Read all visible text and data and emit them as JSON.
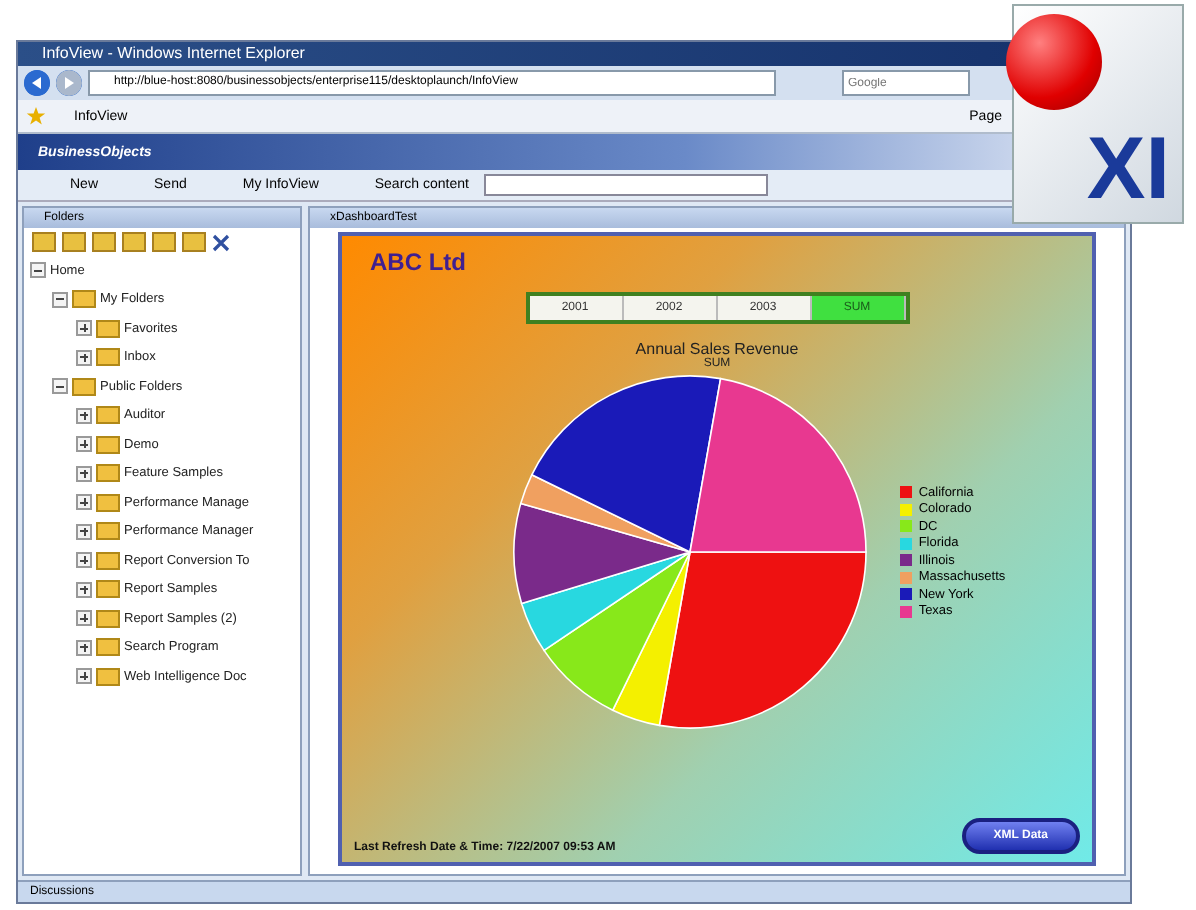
{
  "window": {
    "title": "InfoView - Windows Internet Explorer"
  },
  "address_bar": {
    "value": "http://blue-host:8080/businessobjects/enterprise115/desktoplaunch/InfoView"
  },
  "search": {
    "placeholder": "Google"
  },
  "browser_tab": {
    "label": "InfoView"
  },
  "page_menu": "Page",
  "brand": "BusinessObjects",
  "product_badge": "XI",
  "toolbar": {
    "items": [
      "New",
      "Send",
      "My InfoView"
    ],
    "search_label": "Search content"
  },
  "folders_panel": {
    "title": "Folders",
    "tree": [
      {
        "label": "Home",
        "expanded": true,
        "children": [
          {
            "label": "My Folders",
            "expanded": true,
            "children": [
              {
                "label": "Favorites",
                "expanded": false
              },
              {
                "label": "Inbox",
                "expanded": false
              }
            ]
          },
          {
            "label": "Public Folders",
            "expanded": true,
            "children": [
              {
                "label": "Auditor",
                "expanded": false
              },
              {
                "label": "Demo",
                "expanded": false
              },
              {
                "label": "Feature Samples",
                "expanded": false
              },
              {
                "label": "Performance Manage",
                "expanded": false
              },
              {
                "label": "Performance Manager",
                "expanded": false
              },
              {
                "label": "Report Conversion To",
                "expanded": false
              },
              {
                "label": "Report Samples",
                "expanded": false
              },
              {
                "label": "Report Samples (2)",
                "expanded": false
              },
              {
                "label": "Search Program",
                "expanded": false
              },
              {
                "label": "Web Intelligence Doc",
                "expanded": false
              }
            ]
          }
        ]
      }
    ]
  },
  "pane": {
    "title": "xDashboardTest"
  },
  "dashboard": {
    "company": "ABC Ltd",
    "years": [
      {
        "label": "2001",
        "selected": false
      },
      {
        "label": "2002",
        "selected": false
      },
      {
        "label": "2003",
        "selected": false
      },
      {
        "label": "SUM",
        "selected": true
      }
    ],
    "chart_title": "Annual Sales Revenue",
    "chart_subtitle": "SUM",
    "legend": [
      {
        "label": "California",
        "color": "#ee1111"
      },
      {
        "label": "Colorado",
        "color": "#f4f000"
      },
      {
        "label": "DC",
        "color": "#88e81a"
      },
      {
        "label": "Florida",
        "color": "#28d8e0"
      },
      {
        "label": "Illinois",
        "color": "#7a2a8a"
      },
      {
        "label": "Massachusetts",
        "color": "#f0a060"
      },
      {
        "label": "New York",
        "color": "#1a1ab8"
      },
      {
        "label": "Texas",
        "color": "#e83890"
      }
    ],
    "refresh": "Last Refresh Date & Time: 7/22/2007 09:53 AM",
    "xml_button": "XML Data"
  },
  "footer": {
    "label": "Discussions"
  }
}
